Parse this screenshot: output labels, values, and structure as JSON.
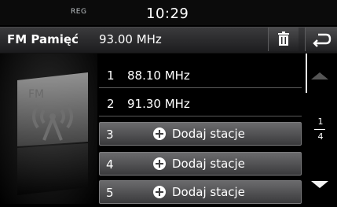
{
  "status": {
    "band": "REG",
    "time": "10:29"
  },
  "header": {
    "title": "FM Pamięć",
    "frequency": "93.00 MHz"
  },
  "art": {
    "label": "FM"
  },
  "presets": [
    {
      "num": "1",
      "label": "88.10 MHz"
    },
    {
      "num": "2",
      "label": "91.30 MHz"
    },
    {
      "num": "3",
      "label": "Dodaj stacje"
    },
    {
      "num": "4",
      "label": "Dodaj stacje"
    },
    {
      "num": "5",
      "label": "Dodaj stacje"
    }
  ],
  "pager": {
    "current": "1",
    "total": "4"
  }
}
